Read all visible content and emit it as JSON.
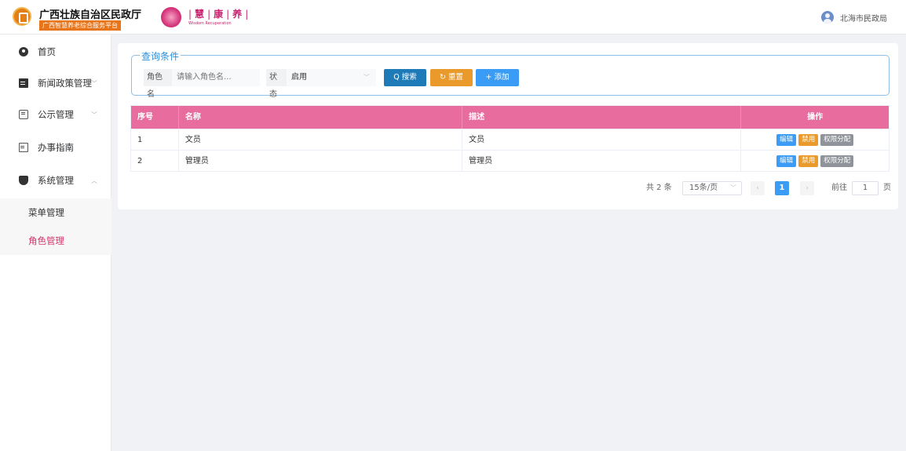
{
  "header": {
    "org_title": "广西壮族自治区民政厅",
    "org_subtitle": "广西智慧养老综合服务平台",
    "brand_chars": [
      "慧",
      "康",
      "养"
    ],
    "brand_subtitle": "Wisdom Recuperation",
    "user_name": "北海市民政局"
  },
  "sidebar": {
    "items": [
      {
        "label": "首页",
        "icon": "dashboard-icon"
      },
      {
        "label": "新闻政策管理",
        "icon": "document-icon",
        "arrow": "﹀"
      },
      {
        "label": "公示管理",
        "icon": "board-icon",
        "arrow": "﹀"
      },
      {
        "label": "办事指南",
        "icon": "file-icon"
      },
      {
        "label": "系统管理",
        "icon": "shield-icon",
        "arrow": "︿"
      }
    ],
    "sub_items": [
      {
        "label": "菜单管理",
        "active": false
      },
      {
        "label": "角色管理",
        "active": true
      }
    ]
  },
  "search": {
    "legend": "查询条件",
    "role_label": "角色名",
    "role_placeholder": "请输入角色名...",
    "status_label": "状态",
    "status_value": "启用",
    "search_label": "Q 搜索",
    "reset_label": "↻ 重置",
    "add_label": "+ 添加"
  },
  "table": {
    "headers": [
      "序号",
      "名称",
      "描述",
      "操作"
    ],
    "rows": [
      {
        "index": "1",
        "name": "文员",
        "desc": "文员"
      },
      {
        "index": "2",
        "name": "管理员",
        "desc": "管理员"
      }
    ],
    "ops": {
      "edit": "编辑",
      "ban": "禁用",
      "perm": "权限分配"
    }
  },
  "pagination": {
    "total": "共 2 条",
    "page_size": "15条/页",
    "prev": "‹",
    "current": "1",
    "next": "›",
    "goto_label": "前往",
    "goto_value": "1",
    "page_suffix": "页"
  },
  "colors": {
    "accent_pink": "#e96c9e",
    "active_menu": "#d6336c",
    "primary_blue": "#3a9cf4",
    "search_blue": "#1f7ab8",
    "warning_orange": "#e99a2b",
    "info_gray": "#909399"
  }
}
